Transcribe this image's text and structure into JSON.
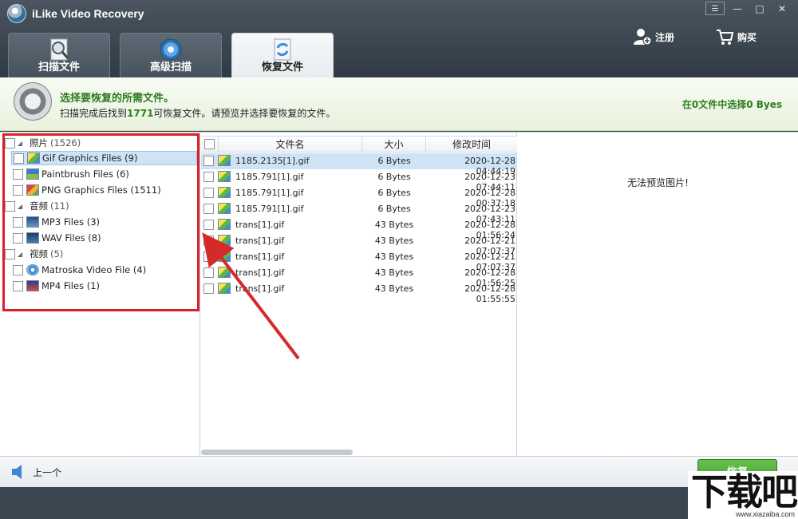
{
  "window": {
    "title": "iLike Video Recovery",
    "controls": [
      "☰",
      "—",
      "□",
      "✕"
    ]
  },
  "tabs": [
    {
      "label": "扫描文件",
      "icon": "magnifier-icon",
      "active": false
    },
    {
      "label": "高级扫描",
      "icon": "gear-icon",
      "active": false
    },
    {
      "label": "恢复文件",
      "icon": "recover-icon",
      "active": true
    }
  ],
  "header_actions": {
    "register": "注册",
    "buy": "购买"
  },
  "banner": {
    "title": "选择要恢复的所需文件。",
    "sub_prefix": "扫描完成后找到",
    "count": "1771",
    "sub_suffix": "可恢复文件。请预览并选择要恢复的文件。",
    "selection": "在0文件中选择0 Byes"
  },
  "tree": {
    "categories": [
      {
        "label": "照片",
        "count": "(1526)",
        "items": [
          {
            "label": "Gif Graphics Files (9)",
            "icon": "gif"
          },
          {
            "label": "Paintbrush Files (6)",
            "icon": "pb"
          },
          {
            "label": "PNG Graphics Files (1511)",
            "icon": "png"
          }
        ]
      },
      {
        "label": "音频",
        "count": "(11)",
        "items": [
          {
            "label": "MP3 Files (3)",
            "icon": "mp3"
          },
          {
            "label": "WAV Files (8)",
            "icon": "wav"
          }
        ]
      },
      {
        "label": "视频",
        "count": "(5)",
        "items": [
          {
            "label": "Matroska Video File (4)",
            "icon": "mkv"
          },
          {
            "label": "MP4 Files (1)",
            "icon": "mp4"
          }
        ]
      }
    ]
  },
  "file_list": {
    "headers": {
      "name": "文件名",
      "size": "大小",
      "time": "修改时间"
    },
    "rows": [
      {
        "name": "1185.2135[1].gif",
        "size": "6 Bytes",
        "time": "2020-12-28 04:44:19"
      },
      {
        "name": "1185.791[1].gif",
        "size": "6 Bytes",
        "time": "2020-12-23 07:44:11"
      },
      {
        "name": "1185.791[1].gif",
        "size": "6 Bytes",
        "time": "2020-12-28 00:37:18"
      },
      {
        "name": "1185.791[1].gif",
        "size": "6 Bytes",
        "time": "2020-12-23 07:43:11"
      },
      {
        "name": "trans[1].gif",
        "size": "43 Bytes",
        "time": "2020-12-28 01:56:24"
      },
      {
        "name": "trans[1].gif",
        "size": "43 Bytes",
        "time": "2020-12-21 07:07:37"
      },
      {
        "name": "trans[1].gif",
        "size": "43 Bytes",
        "time": "2020-12-21 07:07:37"
      },
      {
        "name": "trans[1].gif",
        "size": "43 Bytes",
        "time": "2020-12-28 01:56:25"
      },
      {
        "name": "trans[1].gif",
        "size": "43 Bytes",
        "time": "2020-12-28 01:55:55"
      }
    ]
  },
  "preview": {
    "message": "无法预览图片!"
  },
  "bottom": {
    "back": "上一个",
    "recover": "恢复"
  },
  "watermark": {
    "text": "下载吧",
    "url": "www.xiazaiba.com"
  },
  "colors": {
    "accent_green": "#2c7d1f",
    "highlight_red": "#d9202a",
    "arrow_red": "#d42a2a"
  }
}
